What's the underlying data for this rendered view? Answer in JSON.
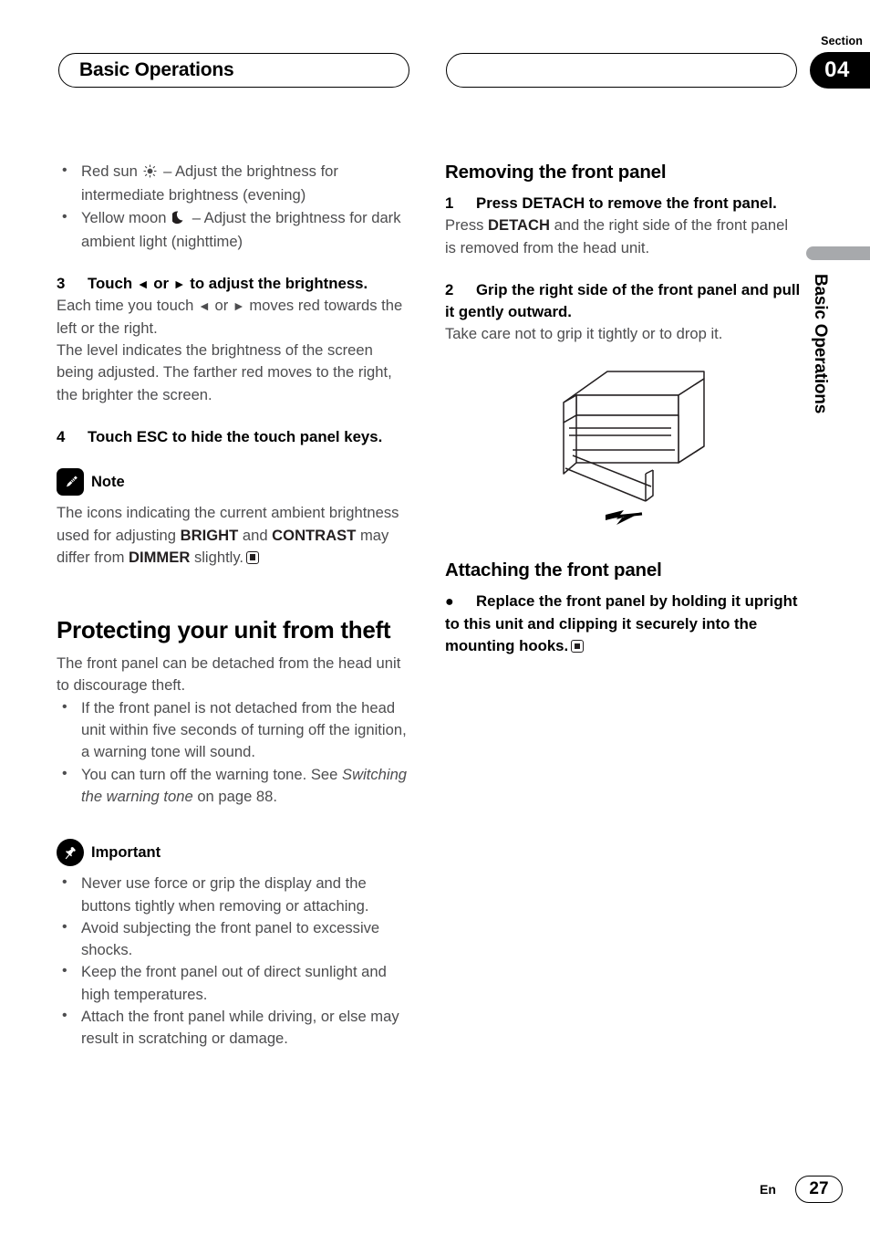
{
  "header": {
    "title": "Basic Operations",
    "section_label": "Section",
    "section_number": "04",
    "right_pill_text": ""
  },
  "margin_tab": {
    "text": "Basic Operations",
    "bar_color": "#a7a9ac"
  },
  "left_column": {
    "bullets_top": [
      {
        "pre": "Red sun",
        "icon": "sun-icon",
        "post": "– Adjust the brightness for intermediate brightness (evening)"
      },
      {
        "pre": "Yellow moon",
        "icon": "moon-icon",
        "post": "– Adjust the brightness for dark ambient light (nighttime)"
      }
    ],
    "step3": {
      "number": "3",
      "text_pre": "Touch",
      "arrow_left": "◄",
      "text_or": "or",
      "arrow_right": "►",
      "text_post": "to adjust the brightness."
    },
    "step3_body_1_pre": "Each time you touch",
    "step3_body_1_mid": "or",
    "step3_body_1_post": "moves red towards the left or the right.",
    "step3_body_2": "The level indicates the brightness of the screen being adjusted. The farther red moves to the right, the brighter the screen.",
    "step4": {
      "number": "4",
      "text": "Touch ESC to hide the touch panel keys."
    },
    "note": {
      "icon": "pencil-icon",
      "label": "Note",
      "text_1": "The icons indicating the current ambient brightness used for adjusting",
      "bold_1": "BRIGHT",
      "text_2": "and",
      "bold_2": "CONTRAST",
      "text_3": "may differ from",
      "bold_3": "DIMMER",
      "text_4": "slightly."
    },
    "heading": "Protecting your unit from theft",
    "intro": "The front panel can be detached from the head unit to discourage theft.",
    "bullets_theft": [
      "If the front panel is not detached from the head unit within five seconds of turning off the ignition, a warning tone will sound."
    ],
    "bullet_warning_tone": {
      "text_pre": "You can turn off the warning tone. See",
      "italic": "Switching the warning tone",
      "text_post": "on page 88."
    },
    "important": {
      "icon": "pushpin-icon",
      "label": "Important",
      "bullets": [
        "Never use force or grip the display and the buttons tightly when removing or attaching.",
        "Avoid subjecting the front panel to excessive shocks.",
        "Keep the front panel out of direct sunlight and high temperatures.",
        "Attach the front panel while driving, or else may result in scratching or damage."
      ]
    }
  },
  "right_column": {
    "heading_removing": "Removing the front panel",
    "step1": {
      "number": "1",
      "text": "Press DETACH to remove the front panel."
    },
    "step1_body_pre": "Press",
    "step1_body_bold": "DETACH",
    "step1_body_post": "and the right side of the front panel is removed from the head unit.",
    "step2": {
      "number": "2",
      "text": "Grip the right side of the front panel and pull it gently outward."
    },
    "step2_body": "Take care not to grip it tightly or to drop it.",
    "figure_caption": "head-unit-detach-illustration",
    "heading_attaching": "Attaching the front panel",
    "attach_bullet": {
      "dot": "●",
      "text": "Replace the front panel by holding it upright to this unit and clipping it securely into the mounting hooks."
    }
  },
  "footer": {
    "language": "En",
    "page_number": "27"
  }
}
